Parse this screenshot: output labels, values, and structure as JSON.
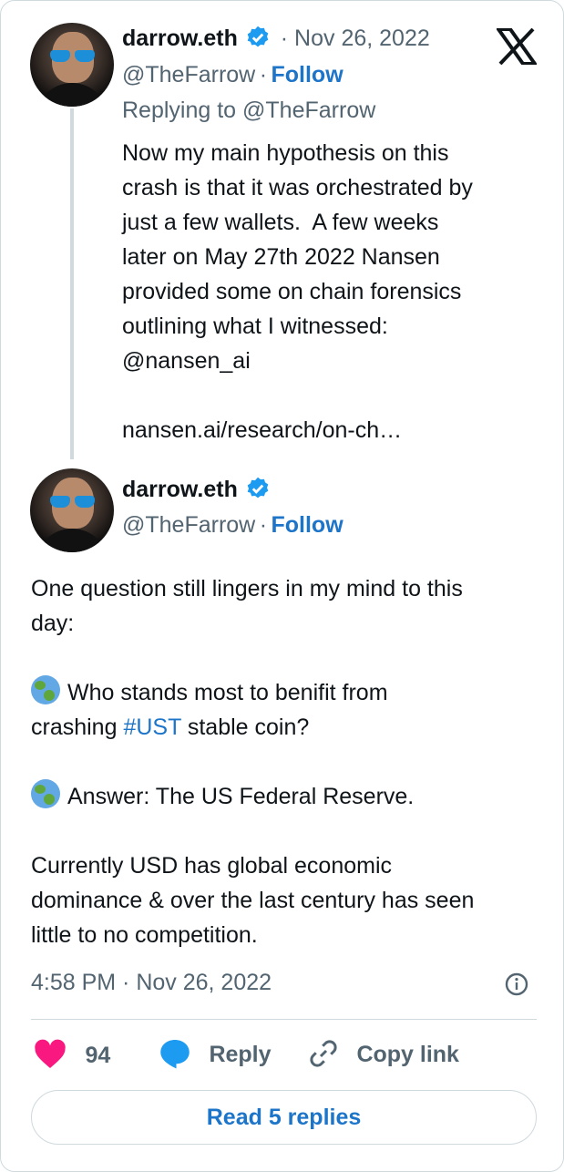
{
  "brand": {
    "logo_icon": "x-logo-icon"
  },
  "tweet1": {
    "name": "darrow.eth",
    "date_sep": "· Nov 26, 2022",
    "handle": "@TheFarrow",
    "dot": "·",
    "follow": "Follow",
    "replying_to_label": "Replying to",
    "replying_to_handle": "@TheFarrow",
    "lines": [
      "Now my main hypothesis on this",
      "crash is that it was orchestrated by",
      "just a few wallets.  A few weeks",
      "later on May 27th 2022 Nansen",
      "provided some on chain forensics",
      "outlining what I witnessed:"
    ],
    "mention": "@nansen_ai",
    "url": "nansen.ai/research/on-ch…"
  },
  "tweet2": {
    "name": "darrow.eth",
    "handle": "@TheFarrow",
    "dot": "·",
    "follow": "Follow",
    "p1_line1": "One question still lingers in my mind to this",
    "p1_line2": "day:",
    "p2_line1": "Who stands most to benifit from",
    "p2_line2_pre": "crashing ",
    "hashtag": "#UST",
    "p2_line2_post": " stable coin?",
    "p3": "Answer: The US Federal Reserve.",
    "p4_line1": "Currently USD has global economic",
    "p4_line2": "dominance & over the last century has seen",
    "p4_line3": "little to no competition.",
    "timestamp": "4:58 PM · Nov 26, 2022"
  },
  "actions": {
    "like_count": "94",
    "reply": "Reply",
    "copy_link": "Copy link"
  },
  "read_replies": "Read 5 replies",
  "colors": {
    "link": "#1d75c9",
    "verified": "#1d9bf0",
    "heart": "#f91880",
    "muted": "#536471"
  }
}
